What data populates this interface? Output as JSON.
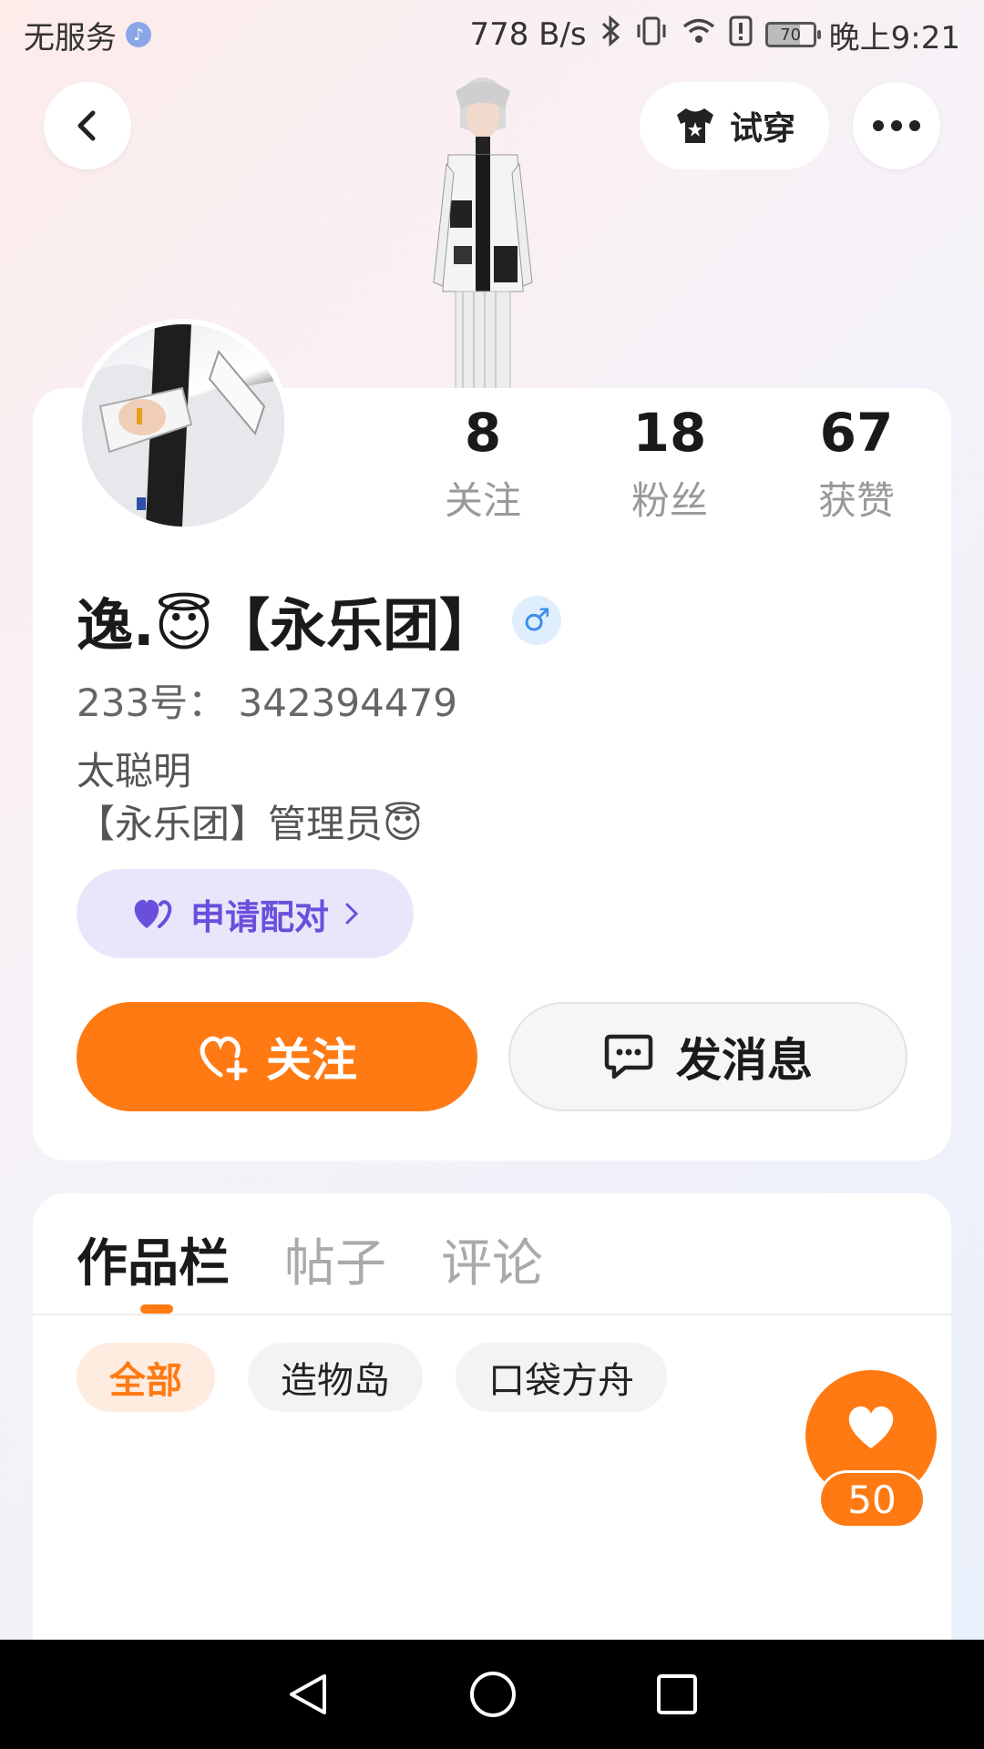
{
  "status_bar": {
    "carrier": "无服务",
    "speed": "778 B/s",
    "battery": "70",
    "time": "晚上9:21"
  },
  "top_nav": {
    "tryon_label": "试穿"
  },
  "stats": [
    {
      "value": "8",
      "label": "关注"
    },
    {
      "value": "18",
      "label": "粉丝"
    },
    {
      "value": "67",
      "label": "获赞"
    }
  ],
  "profile": {
    "name": "逸.😇【永乐团】",
    "gender_symbol": "♂",
    "uid": "233号： 342394479",
    "bio": "太聪明\n【永乐团】管理员😇"
  },
  "actions": {
    "pair_label": "申请配对",
    "follow_label": "关注",
    "message_label": "发消息"
  },
  "tabs": [
    {
      "label": "作品栏",
      "active": true
    },
    {
      "label": "帖子",
      "active": false
    },
    {
      "label": "评论",
      "active": false
    }
  ],
  "filters": [
    {
      "label": "全部",
      "active": true
    },
    {
      "label": "造物岛",
      "active": false
    },
    {
      "label": "口袋方舟",
      "active": false
    }
  ],
  "like_fab": {
    "count": "50"
  },
  "colors": {
    "accent": "#ff7a12",
    "pair": "#6a4fdc",
    "gender": "#3b8fe6"
  }
}
